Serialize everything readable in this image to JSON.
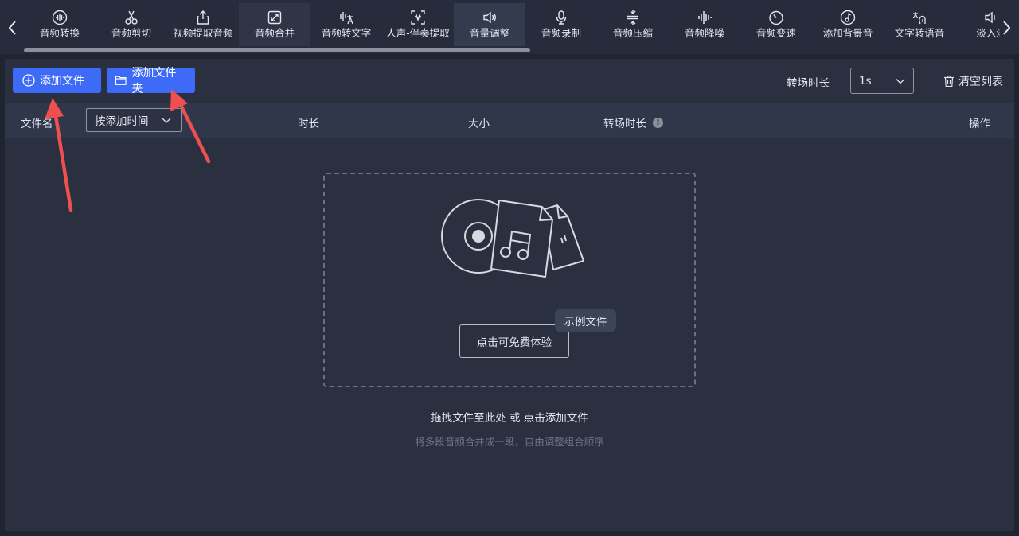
{
  "toolbar": {
    "tools": [
      {
        "label": "音频转换",
        "icon": "audio-wave-icon"
      },
      {
        "label": "音频剪切",
        "icon": "scissors-icon"
      },
      {
        "label": "视频提取音频",
        "icon": "upload-export-icon"
      },
      {
        "label": "音频合并",
        "icon": "merge-expand-icon"
      },
      {
        "label": "音频转文字",
        "icon": "speech-to-text-icon"
      },
      {
        "label": "人声-伴奏提取",
        "icon": "vocal-extract-icon"
      },
      {
        "label": "音量调整",
        "icon": "volume-icon"
      },
      {
        "label": "音频录制",
        "icon": "microphone-icon"
      },
      {
        "label": "音频压缩",
        "icon": "compress-icon"
      },
      {
        "label": "音频降噪",
        "icon": "denoise-bars-icon"
      },
      {
        "label": "音频变速",
        "icon": "speed-dial-icon"
      },
      {
        "label": "添加背景音",
        "icon": "music-note-circle-icon"
      },
      {
        "label": "文字转语音",
        "icon": "text-to-speech-icon"
      },
      {
        "label": "淡入淡",
        "icon": "fade-icon"
      }
    ],
    "active_tool": "音频合并",
    "scroll_position_fraction": 0.52
  },
  "panel": {
    "add_file": "添加文件",
    "add_folder": "添加文件夹",
    "transition_label": "转场时长",
    "transition_value": "1s",
    "clear_list": "清空列表"
  },
  "table": {
    "col_name": "文件名",
    "sort_value": "按添加时间",
    "col_duration": "时长",
    "col_size": "大小",
    "col_transition": "转场时长",
    "col_ops": "操作"
  },
  "dropzone": {
    "try_button": "点击可免费体验",
    "sample_badge": "示例文件",
    "hint": "拖拽文件至此处 或 点击添加文件",
    "sub_hint": "将多段音频合并成一段，自由调整组合顺序"
  },
  "colors": {
    "accent": "#3d6bf7",
    "background": "#1f2431",
    "panel": "#2a3040",
    "annotation_arrow": "#ef4f4f"
  }
}
